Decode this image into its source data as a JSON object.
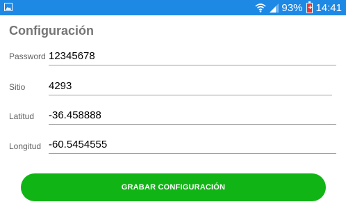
{
  "status_bar": {
    "battery_percent": "93%",
    "time": "14:41",
    "icons": [
      "image-notification-icon",
      "wifi-icon",
      "signal-icon",
      "battery-icon"
    ],
    "color": "#1e88e5"
  },
  "page": {
    "title": "Configuración"
  },
  "fields": {
    "password": {
      "label": "Password",
      "value": "12345678"
    },
    "sitio": {
      "label": "Sitio",
      "value": "4293"
    },
    "latitud": {
      "label": "Latitud",
      "value": "-36.458888"
    },
    "longitud": {
      "label": "Longitud",
      "value": "-60.5454555"
    }
  },
  "actions": {
    "save_label": "GRABAR CONFIGURACIÓN",
    "color": "#10b515"
  }
}
